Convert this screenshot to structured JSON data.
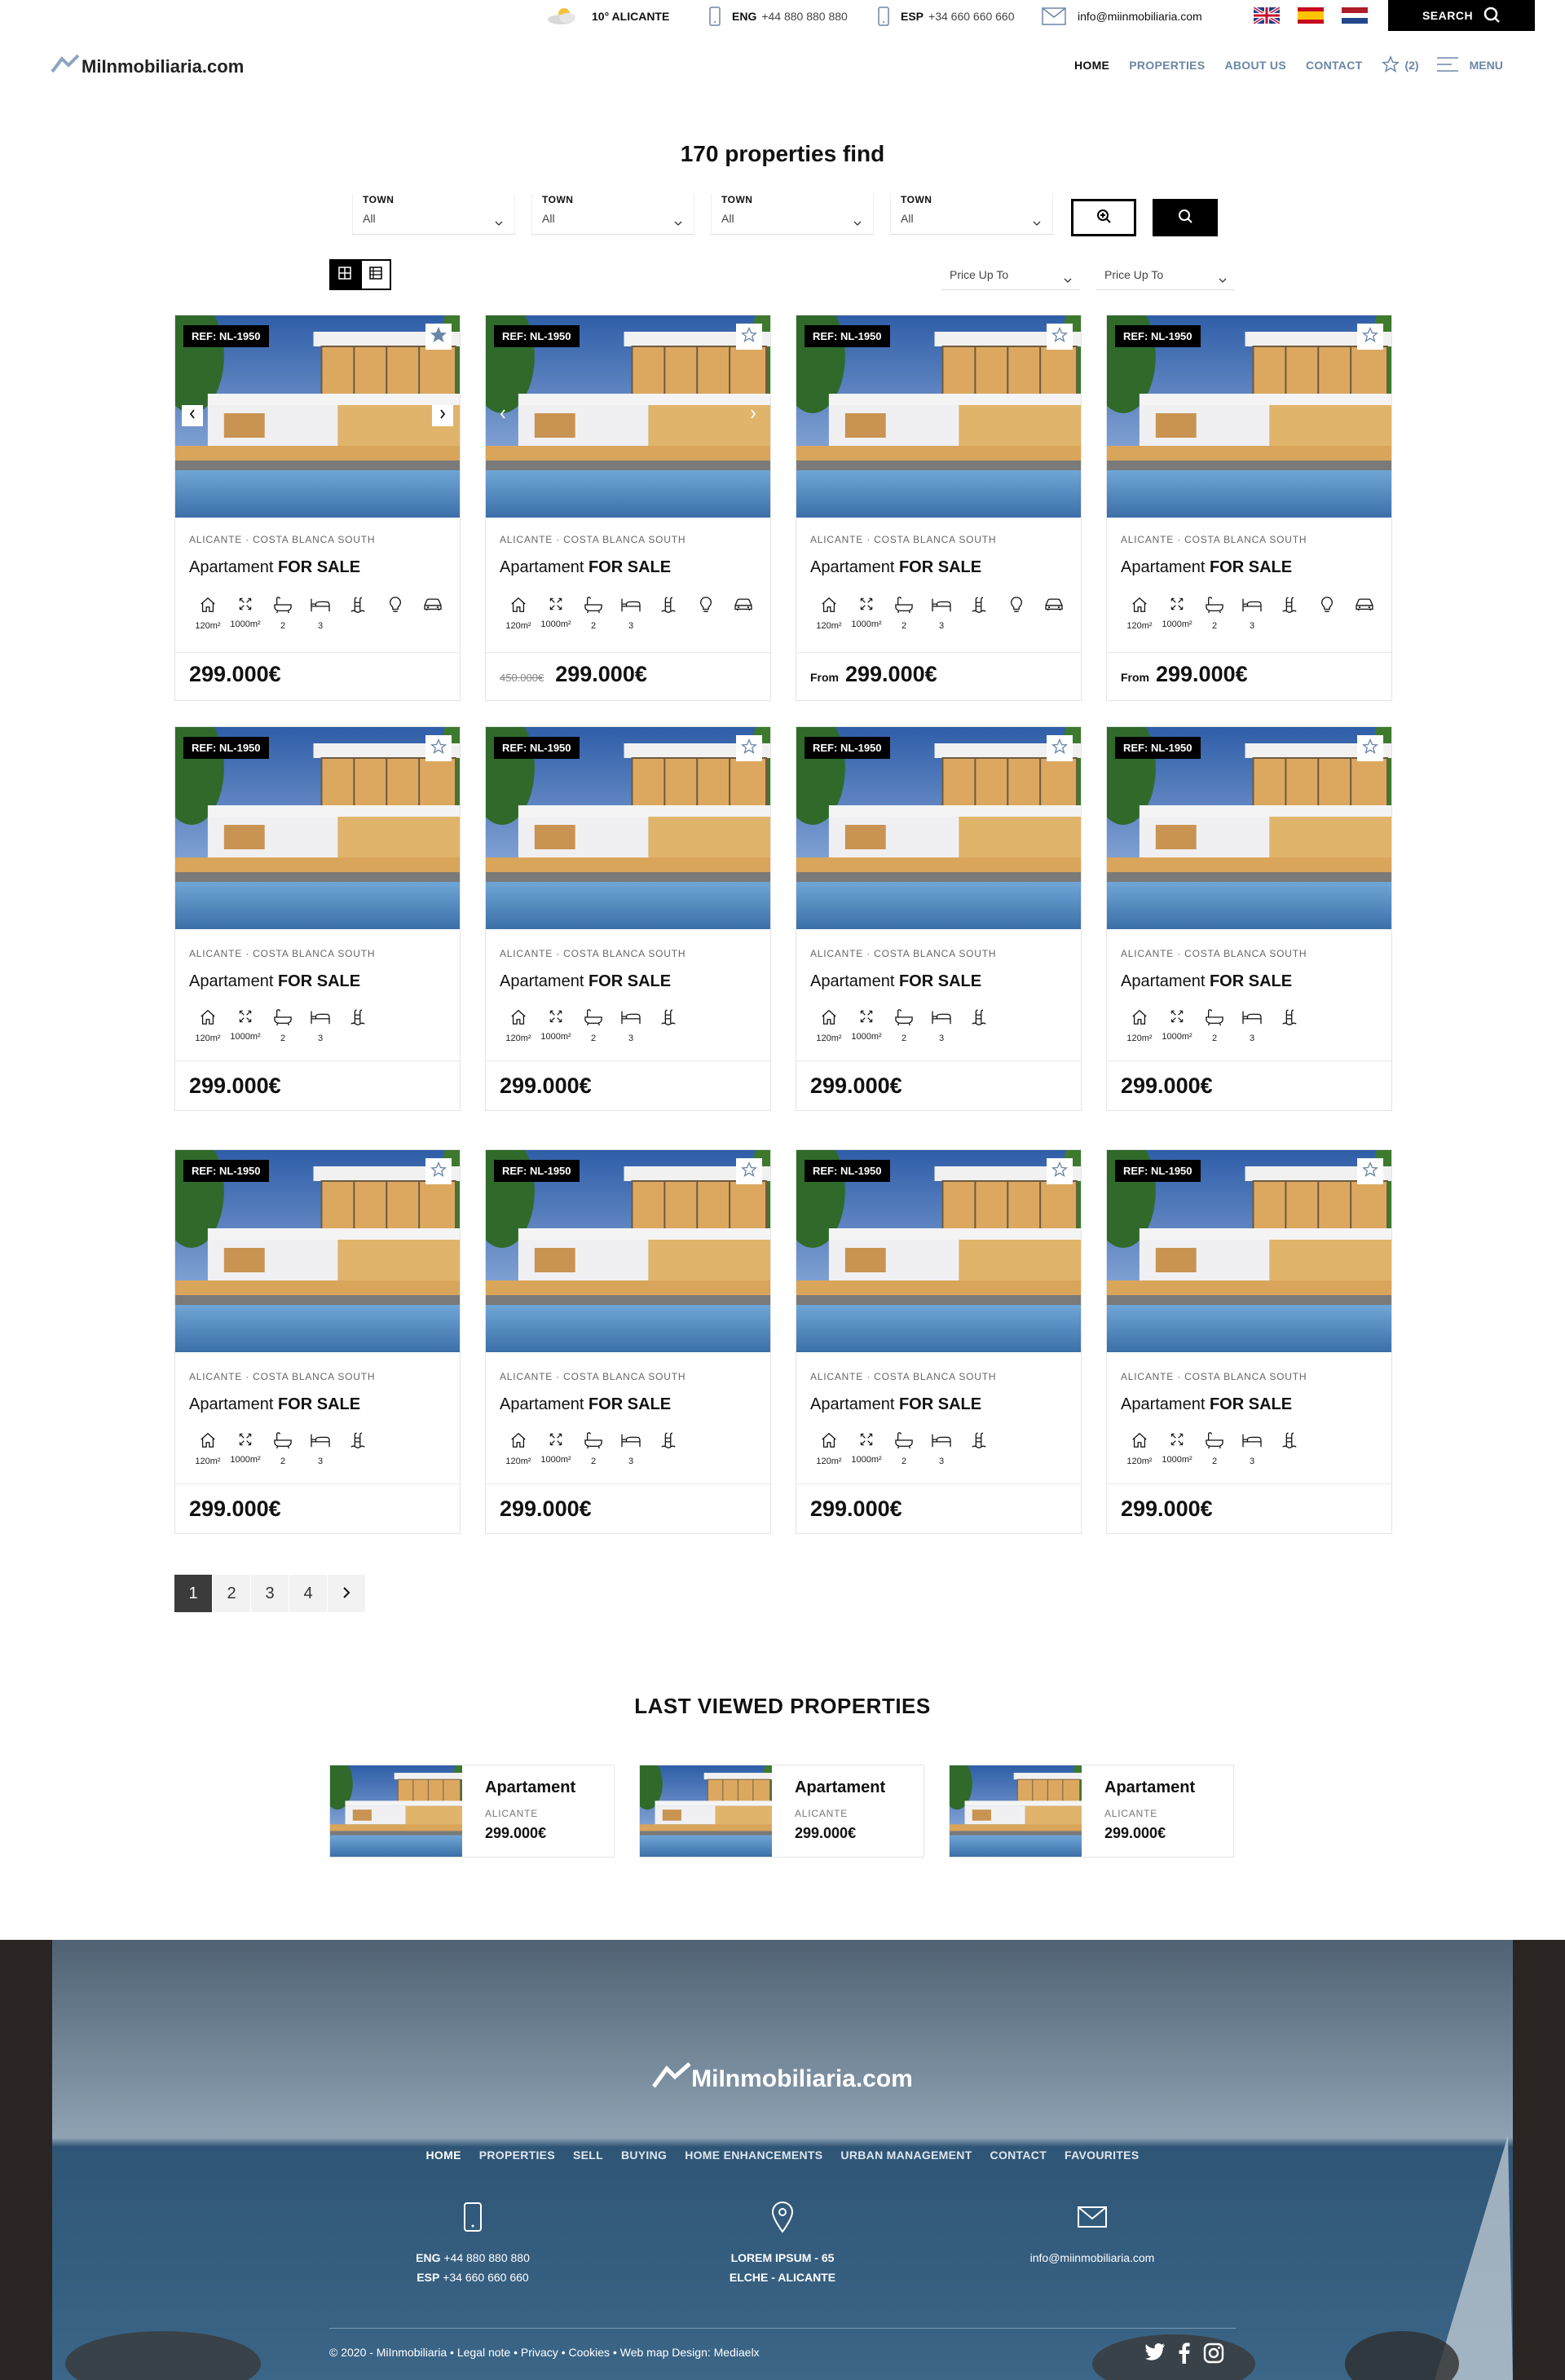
{
  "topbar": {
    "weather": "10° ALICANTE",
    "phone_eng_label": "ENG",
    "phone_eng": "+44 880 880 880",
    "phone_esp_label": "ESP",
    "phone_esp": "+34 660 660 660",
    "email": "info@miinmobiliaria.com",
    "search_label": "SEARCH"
  },
  "header": {
    "logo": "MiInmobiliaria.com",
    "nav": [
      "HOME",
      "PROPERTIES",
      "ABOUT US",
      "CONTACT"
    ],
    "favourites_count": "(2)",
    "menu_label": "MENU"
  },
  "results": {
    "title": "170 properties find",
    "filters": [
      {
        "label": "TOWN",
        "value": "All"
      },
      {
        "label": "TOWN",
        "value": "All"
      },
      {
        "label": "TOWN",
        "value": "All"
      },
      {
        "label": "TOWN",
        "value": "All"
      }
    ],
    "price_selects": [
      "Price Up To",
      "Price Up To"
    ]
  },
  "cards": [
    {
      "ref": "REF: NL-1950",
      "location": "ALICANTE · COSTA BLANCA SOUTH",
      "type": "Apartament",
      "status": "FOR SALE",
      "size": "120m²",
      "plot": "1000m²",
      "baths": "2",
      "beds": "3",
      "price": "299.000€",
      "old_price": "",
      "from": "",
      "extra_icons": true,
      "starred": true,
      "arrows": "solid"
    },
    {
      "ref": "REF: NL-1950",
      "location": "ALICANTE · COSTA BLANCA SOUTH",
      "type": "Apartament",
      "status": "FOR SALE",
      "size": "120m²",
      "plot": "1000m²",
      "baths": "2",
      "beds": "3",
      "price": "299.000€",
      "old_price": "450.000€",
      "from": "",
      "extra_icons": true,
      "starred": false,
      "arrows": "ghost"
    },
    {
      "ref": "REF: NL-1950",
      "location": "ALICANTE · COSTA BLANCA SOUTH",
      "type": "Apartament",
      "status": "FOR SALE",
      "size": "120m²",
      "plot": "1000m²",
      "baths": "2",
      "beds": "3",
      "price": "299.000€",
      "old_price": "",
      "from": "From",
      "extra_icons": true,
      "starred": false,
      "arrows": "none"
    },
    {
      "ref": "REF: NL-1950",
      "location": "ALICANTE · COSTA BLANCA SOUTH",
      "type": "Apartament",
      "status": "FOR SALE",
      "size": "120m²",
      "plot": "1000m²",
      "baths": "2",
      "beds": "3",
      "price": "299.000€",
      "old_price": "",
      "from": "From",
      "extra_icons": true,
      "starred": false,
      "arrows": "none"
    },
    {
      "ref": "REF: NL-1950",
      "location": "ALICANTE · COSTA BLANCA SOUTH",
      "type": "Apartament",
      "status": "FOR SALE",
      "size": "120m²",
      "plot": "1000m²",
      "baths": "2",
      "beds": "3",
      "price": "299.000€",
      "old_price": "",
      "from": "",
      "extra_icons": false,
      "starred": false,
      "arrows": "none"
    },
    {
      "ref": "REF: NL-1950",
      "location": "ALICANTE · COSTA BLANCA SOUTH",
      "type": "Apartament",
      "status": "FOR SALE",
      "size": "120m²",
      "plot": "1000m²",
      "baths": "2",
      "beds": "3",
      "price": "299.000€",
      "old_price": "",
      "from": "",
      "extra_icons": false,
      "starred": false,
      "arrows": "none"
    },
    {
      "ref": "REF: NL-1950",
      "location": "ALICANTE · COSTA BLANCA SOUTH",
      "type": "Apartament",
      "status": "FOR SALE",
      "size": "120m²",
      "plot": "1000m²",
      "baths": "2",
      "beds": "3",
      "price": "299.000€",
      "old_price": "",
      "from": "",
      "extra_icons": false,
      "starred": false,
      "arrows": "none"
    },
    {
      "ref": "REF: NL-1950",
      "location": "ALICANTE · COSTA BLANCA SOUTH",
      "type": "Apartament",
      "status": "FOR SALE",
      "size": "120m²",
      "plot": "1000m²",
      "baths": "2",
      "beds": "3",
      "price": "299.000€",
      "old_price": "",
      "from": "",
      "extra_icons": false,
      "starred": false,
      "arrows": "none"
    },
    {
      "ref": "REF: NL-1950",
      "location": "ALICANTE · COSTA BLANCA SOUTH",
      "type": "Apartament",
      "status": "FOR SALE",
      "size": "120m²",
      "plot": "1000m²",
      "baths": "2",
      "beds": "3",
      "price": "299.000€",
      "old_price": "",
      "from": "",
      "extra_icons": false,
      "starred": false,
      "arrows": "none"
    },
    {
      "ref": "REF: NL-1950",
      "location": "ALICANTE · COSTA BLANCA SOUTH",
      "type": "Apartament",
      "status": "FOR SALE",
      "size": "120m²",
      "plot": "1000m²",
      "baths": "2",
      "beds": "3",
      "price": "299.000€",
      "old_price": "",
      "from": "",
      "extra_icons": false,
      "starred": false,
      "arrows": "none"
    },
    {
      "ref": "REF: NL-1950",
      "location": "ALICANTE · COSTA BLANCA SOUTH",
      "type": "Apartament",
      "status": "FOR SALE",
      "size": "120m²",
      "plot": "1000m²",
      "baths": "2",
      "beds": "3",
      "price": "299.000€",
      "old_price": "",
      "from": "",
      "extra_icons": false,
      "starred": false,
      "arrows": "none"
    },
    {
      "ref": "REF: NL-1950",
      "location": "ALICANTE · COSTA BLANCA SOUTH",
      "type": "Apartament",
      "status": "FOR SALE",
      "size": "120m²",
      "plot": "1000m²",
      "baths": "2",
      "beds": "3",
      "price": "299.000€",
      "old_price": "",
      "from": "",
      "extra_icons": false,
      "starred": false,
      "arrows": "none"
    }
  ],
  "pagination": {
    "pages": [
      "1",
      "2",
      "3",
      "4"
    ],
    "current": "1"
  },
  "last_viewed": {
    "title": "LAST VIEWED PROPERTIES",
    "items": [
      {
        "name": "Apartament",
        "city": "ALICANTE",
        "price": "299.000€"
      },
      {
        "name": "Apartament",
        "city": "ALICANTE",
        "price": "299.000€"
      },
      {
        "name": "Apartament",
        "city": "ALICANTE",
        "price": "299.000€"
      }
    ]
  },
  "footer": {
    "logo": "MiInmobiliaria.com",
    "nav": [
      "HOME",
      "PROPERTIES",
      "SELL",
      "BUYING",
      "HOME ENHANCEMENTS",
      "URBAN MANAGEMENT",
      "CONTACT",
      "FAVOURITES"
    ],
    "phone_eng_label": "ENG",
    "phone_eng": "+44 880 880 880",
    "phone_esp_label": "ESP",
    "phone_esp": "+34 660 660 660",
    "address_line1": "LOREM IPSUM - 65",
    "address_line2": "ELCHE - ALICANTE",
    "email": "info@miinmobiliaria.com",
    "copyright": "© 2020 - MiInmobiliaria • Legal note • Privacy • Cookies • Web map   Design: Mediaelx"
  },
  "colors": {
    "accent": "#000000",
    "nav_link": "#6b86a7",
    "footer_bg": "#5e7386"
  }
}
